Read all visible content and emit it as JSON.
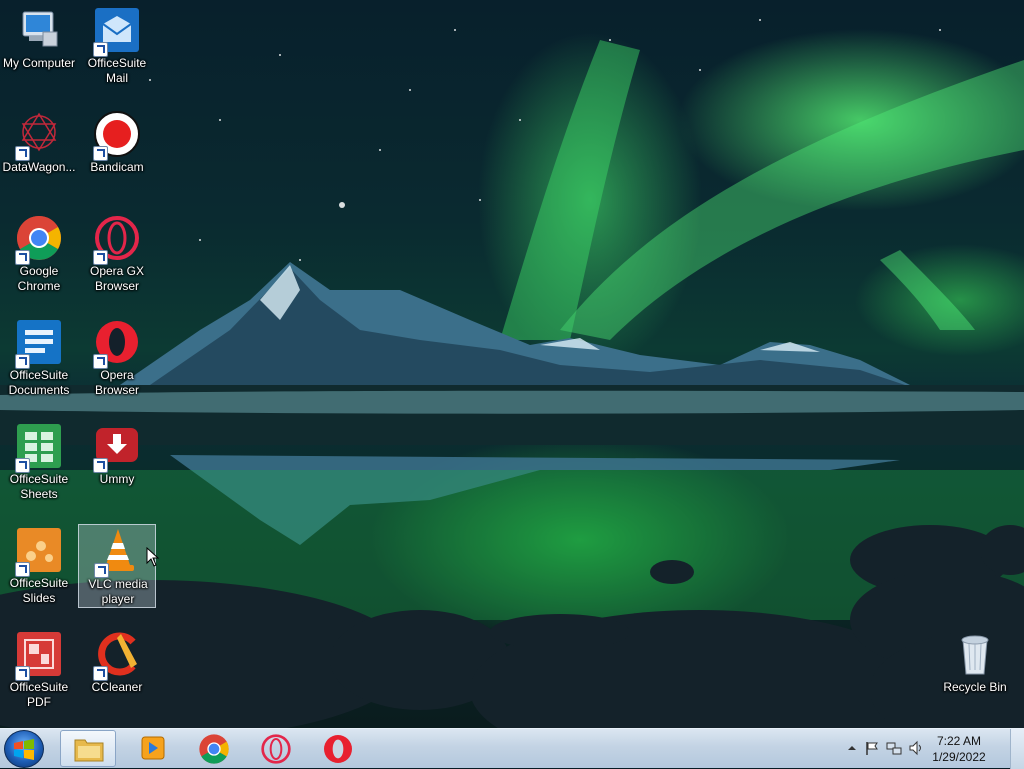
{
  "desktop": {
    "icons": [
      {
        "id": "my-computer",
        "label": "My Computer",
        "icon": "computer-icon"
      },
      {
        "id": "officesuite-mail",
        "label": "OfficeSuite Mail",
        "icon": "mail-icon"
      },
      {
        "id": "datawagon",
        "label": "DataWagon...",
        "icon": "datawagon-icon"
      },
      {
        "id": "bandicam",
        "label": "Bandicam",
        "icon": "record-icon"
      },
      {
        "id": "google-chrome",
        "label": "Google Chrome",
        "icon": "chrome-icon"
      },
      {
        "id": "opera-gx",
        "label": "Opera GX Browser",
        "icon": "opera-gx-icon"
      },
      {
        "id": "officesuite-documents",
        "label": "OfficeSuite Documents",
        "icon": "documents-icon"
      },
      {
        "id": "opera-browser",
        "label": "Opera Browser",
        "icon": "opera-icon"
      },
      {
        "id": "officesuite-sheets",
        "label": "OfficeSuite Sheets",
        "icon": "sheets-icon"
      },
      {
        "id": "ummy",
        "label": "Ummy",
        "icon": "download-icon"
      },
      {
        "id": "officesuite-slides",
        "label": "OfficeSuite Slides",
        "icon": "slides-icon"
      },
      {
        "id": "vlc",
        "label": "VLC media player",
        "icon": "vlc-cone-icon",
        "selected": true
      },
      {
        "id": "officesuite-pdf",
        "label": "OfficeSuite PDF",
        "icon": "pdf-icon"
      },
      {
        "id": "ccleaner",
        "label": "CCleaner",
        "icon": "ccleaner-icon"
      },
      {
        "id": "recycle-bin",
        "label": "Recycle Bin",
        "icon": "recycle-bin-icon"
      }
    ]
  },
  "taskbar": {
    "pinned": [
      {
        "name": "windows-explorer",
        "icon": "folder-icon",
        "active": true
      },
      {
        "name": "media-player",
        "icon": "media-player-icon"
      },
      {
        "name": "google-chrome",
        "icon": "chrome-icon"
      },
      {
        "name": "opera-gx",
        "icon": "opera-gx-icon"
      },
      {
        "name": "opera",
        "icon": "opera-icon"
      }
    ],
    "tray": {
      "time": "7:22 AM",
      "date": "1/29/2022",
      "icons": [
        "chevron-up-icon",
        "action-center-flag-icon",
        "network-icon",
        "volume-icon"
      ]
    }
  },
  "colors": {
    "taskbar": "#c3d3e4",
    "aurora": "#46f06e",
    "selection": "#bec8d2"
  }
}
